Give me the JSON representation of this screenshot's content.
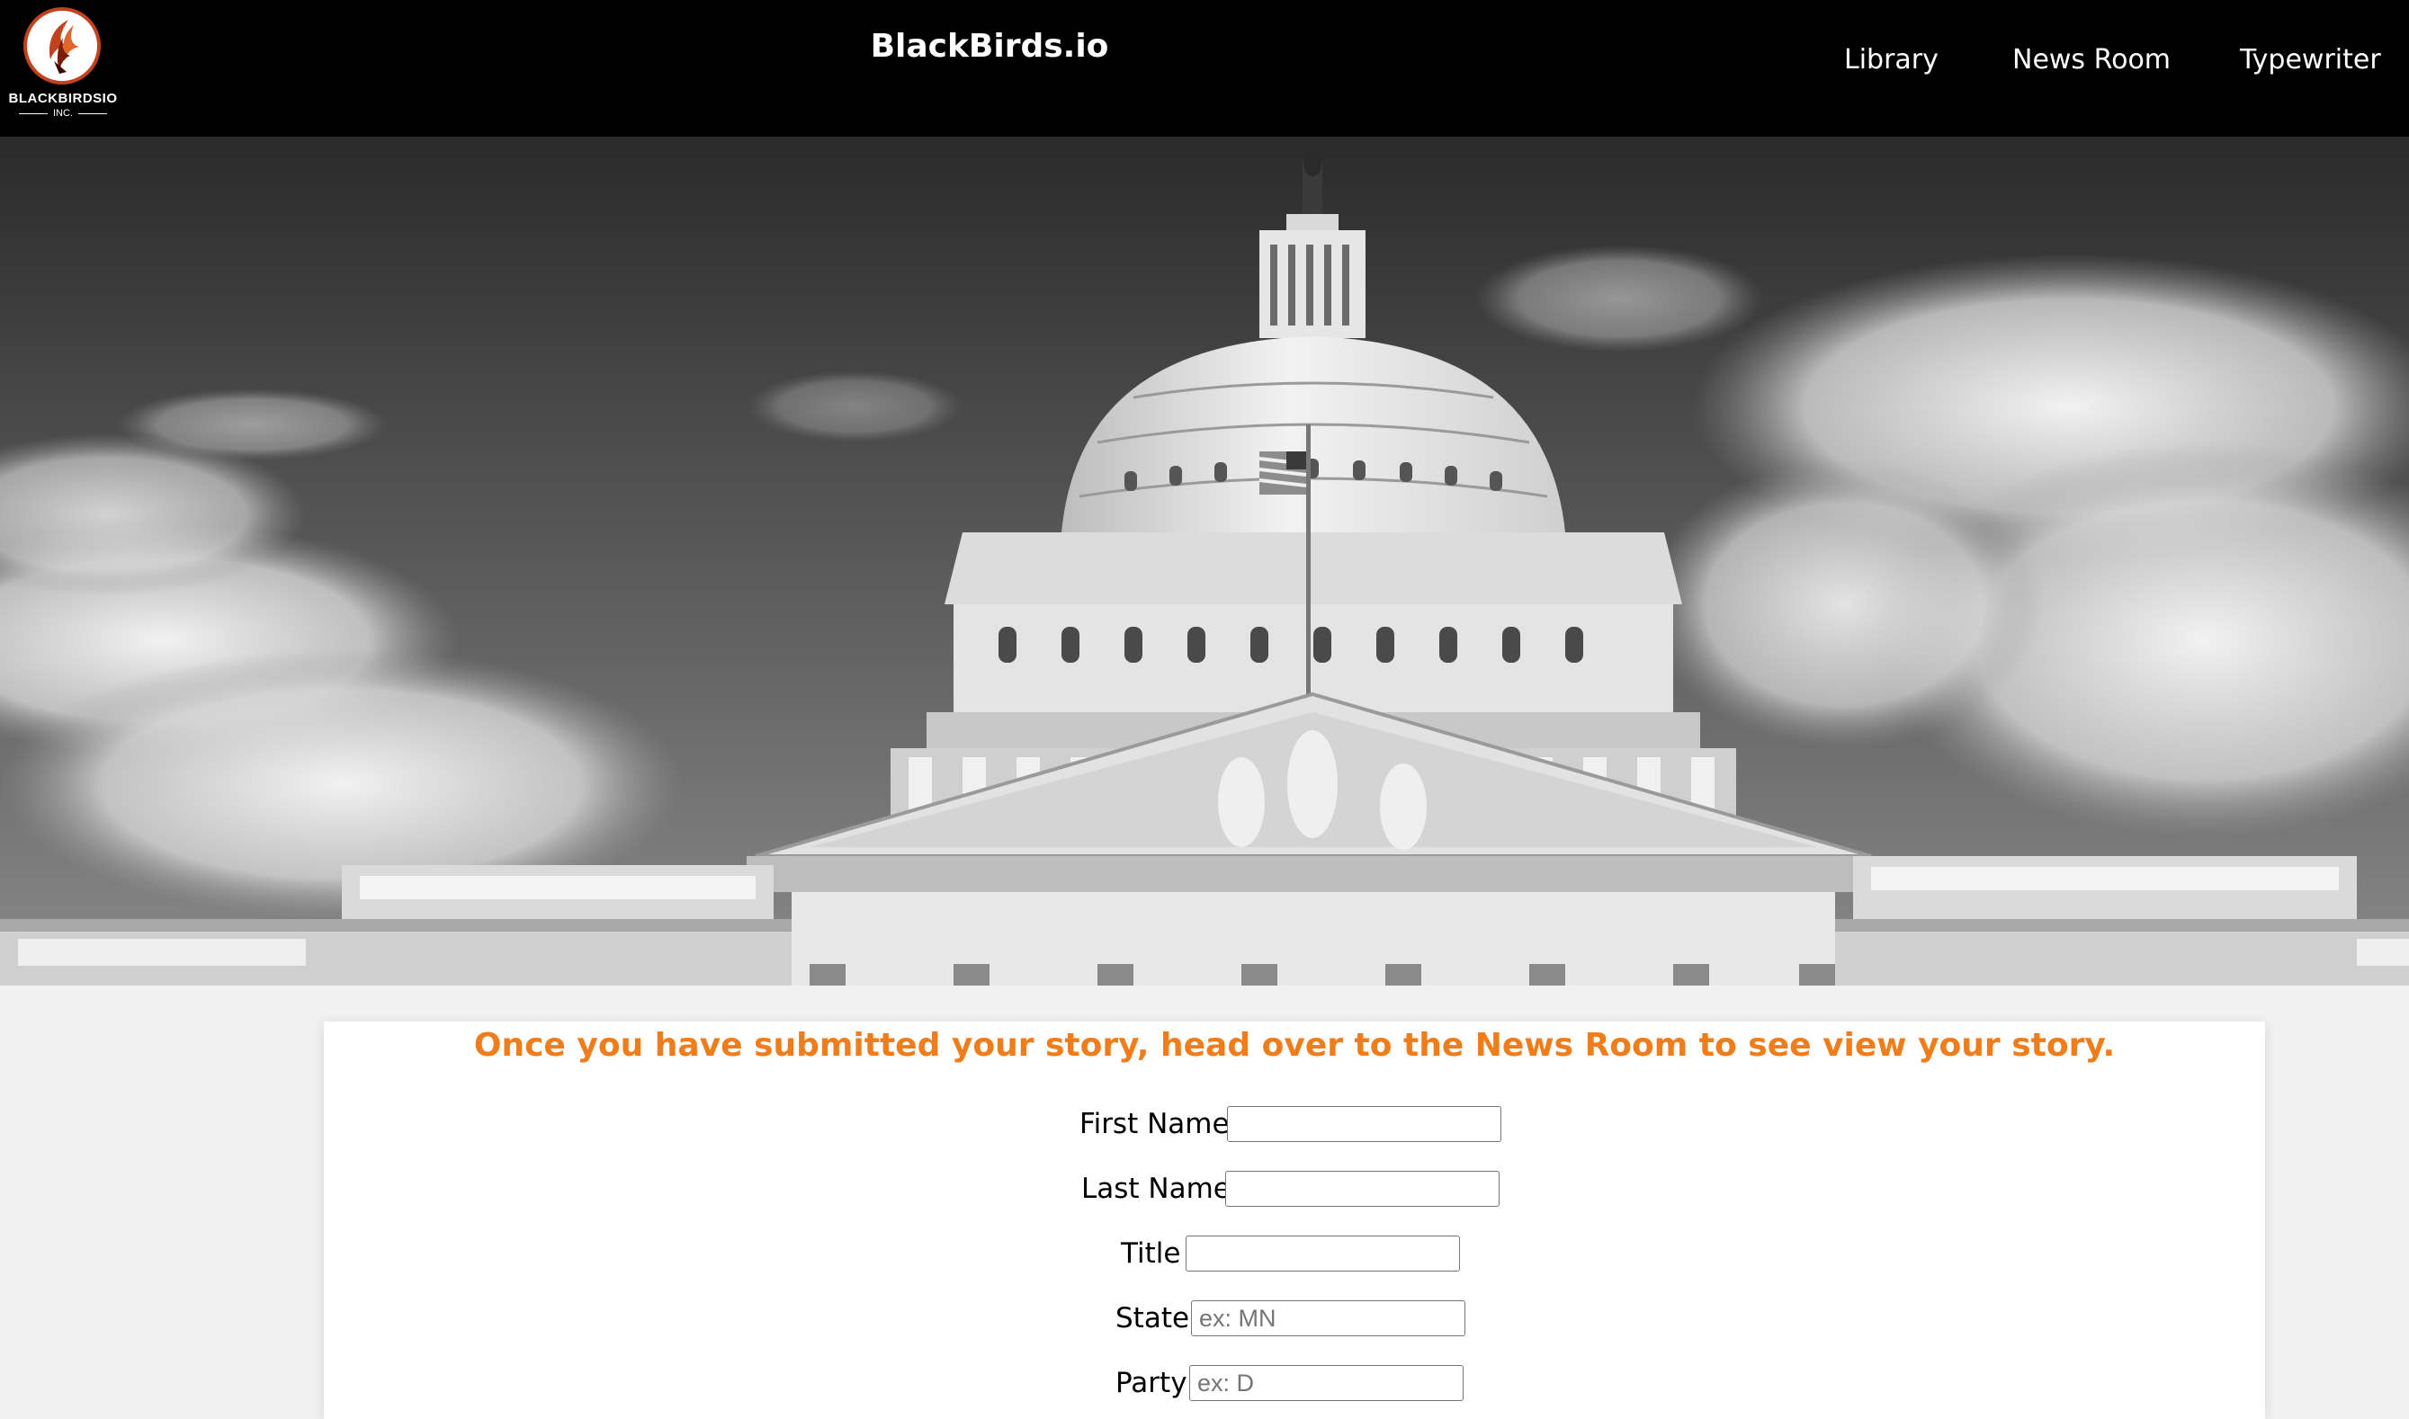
{
  "header": {
    "logo_text": "BLACKBIRDSIO",
    "logo_subtext": "INC.",
    "site_title": "BlackBirds.io",
    "nav": [
      {
        "label": "Library"
      },
      {
        "label": "News Room"
      },
      {
        "label": "Typewriter"
      }
    ]
  },
  "hero": {
    "icon": "capitol-dome-photo"
  },
  "form": {
    "notice": "Once you have submitted your story, head over to the News Room to see view your story.",
    "fields": [
      {
        "label": "First Name",
        "value": "",
        "placeholder": ""
      },
      {
        "label": "Last Name",
        "value": "",
        "placeholder": ""
      },
      {
        "label": "Title",
        "value": "",
        "placeholder": ""
      },
      {
        "label": "State",
        "value": "",
        "placeholder": "ex: MN"
      },
      {
        "label": "Party",
        "value": "",
        "placeholder": "ex: D"
      }
    ]
  },
  "colors": {
    "header_bg": "#000000",
    "notice": "#f07d1b",
    "page_bg": "#f1f1f1",
    "logo_ring": "#c2421e"
  }
}
